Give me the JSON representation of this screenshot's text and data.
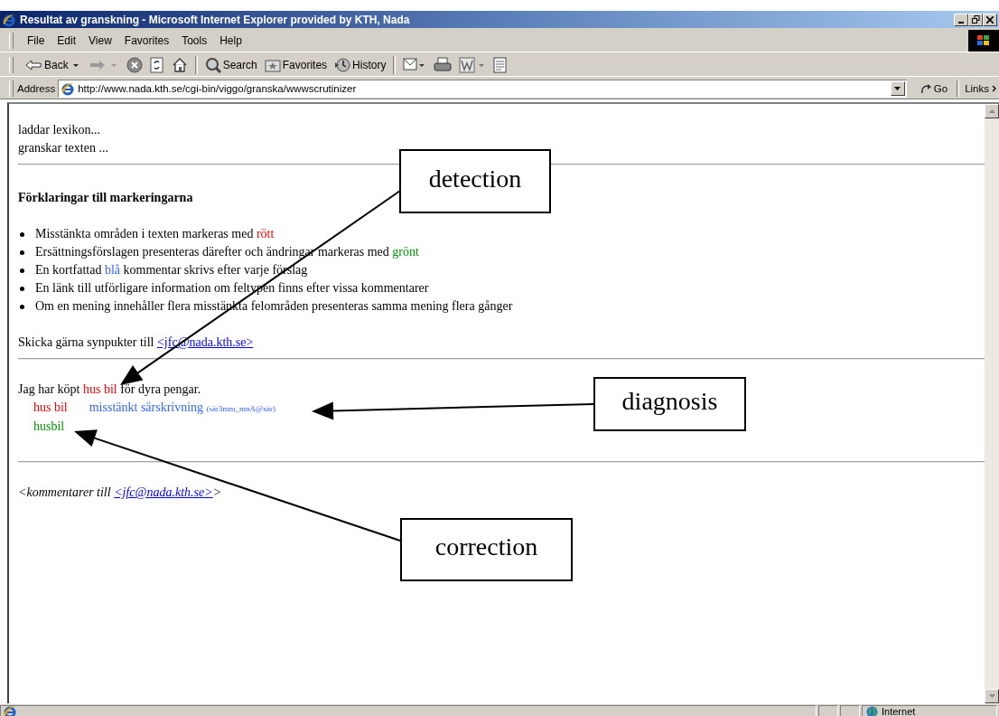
{
  "window": {
    "title": "Resultat av granskning - Microsoft Internet Explorer provided by KTH, Nada"
  },
  "menu": [
    "File",
    "Edit",
    "View",
    "Favorites",
    "Tools",
    "Help"
  ],
  "toolbar": [
    {
      "kind": "back",
      "label": "Back"
    },
    {
      "kind": "forward"
    },
    {
      "kind": "stop"
    },
    {
      "kind": "refresh"
    },
    {
      "kind": "home"
    },
    {
      "kind": "search",
      "label": "Search"
    },
    {
      "kind": "favorites",
      "label": "Favorites"
    },
    {
      "kind": "history",
      "label": "History"
    },
    {
      "kind": "mail"
    },
    {
      "kind": "print"
    },
    {
      "kind": "edit"
    },
    {
      "kind": "discuss"
    }
  ],
  "address_bar": {
    "label": "Address",
    "url": "http://www.nada.kth.se/cgi-bin/viggo/granska/wwwscrutinizer",
    "go": "Go",
    "links": "Links"
  },
  "page": {
    "status_lines": [
      "laddar lexikon...",
      "granskar texten ..."
    ],
    "heading": "Förklaringar till markeringarna",
    "bullets": [
      {
        "before": "Misstänkta områden i texten markeras med ",
        "marked": "rött",
        "kind": "error"
      },
      {
        "before": "Ersättningsförslagen presenteras därefter och ändringar markeras med ",
        "marked": "grönt",
        "kind": "correction"
      },
      {
        "before": "En kortfattad ",
        "marked": "blå",
        "kind": "comment",
        "after": " kommentar skrivs efter varje förslag"
      },
      {
        "before": "En länk till utförligare information om feltypen finns efter vissa kommentarer"
      },
      {
        "before": "Om en mening innehåller flera misstänkta felområden presenteras samma mening flera gånger"
      }
    ],
    "feedback": {
      "text": "Skicka gärna synpukter till ",
      "link": "<jfc@nada.kth.se>"
    },
    "sentence": {
      "before": "Jag har köpt ",
      "error": "hus bil",
      "after": " för dyra pengar."
    },
    "detail": {
      "error": "hus bil",
      "diagnosis": "misstänkt särskrivning",
      "code": "(sär3mm_mnA@sär)",
      "correction": "husbil"
    },
    "footer": {
      "before": "<kommentarer till ",
      "link": "<jfc@nada.kth.se>",
      "after": ">"
    }
  },
  "annotations": [
    {
      "label": "detection"
    },
    {
      "label": "diagnosis"
    },
    {
      "label": "correction"
    }
  ],
  "status_bar": {
    "zone": "Internet"
  }
}
